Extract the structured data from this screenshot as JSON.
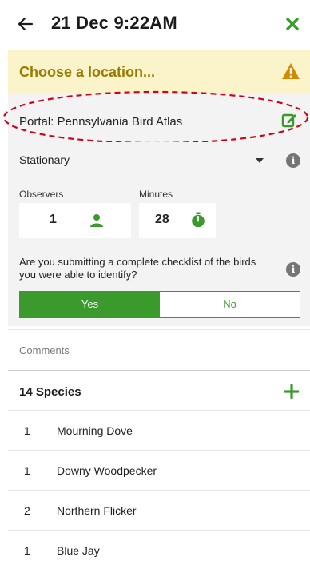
{
  "header": {
    "title": "21 Dec 9:22AM"
  },
  "location": {
    "prompt": "Choose a location..."
  },
  "portal": {
    "label": "Portal: Pennsylvania Bird Atlas"
  },
  "protocol": {
    "value": "Stationary"
  },
  "observers": {
    "label": "Observers",
    "value": "1"
  },
  "minutes": {
    "label": "Minutes",
    "value": "28"
  },
  "complete_checklist": {
    "question": "Are you submitting a complete checklist of the birds you were able to identify?",
    "yes_label": "Yes",
    "no_label": "No",
    "selected": "Yes"
  },
  "comments": {
    "placeholder": "Comments"
  },
  "species": {
    "header": "14 Species",
    "items": [
      {
        "count": "1",
        "name": "Mourning Dove"
      },
      {
        "count": "1",
        "name": "Downy Woodpecker"
      },
      {
        "count": "2",
        "name": "Northern Flicker"
      },
      {
        "count": "1",
        "name": "Blue Jay"
      }
    ]
  },
  "colors": {
    "accent_green": "#3a9a2c",
    "warning_banner": "#fbf3c9",
    "warning_text": "#9a7a00",
    "annotation_red": "#d0021b"
  }
}
